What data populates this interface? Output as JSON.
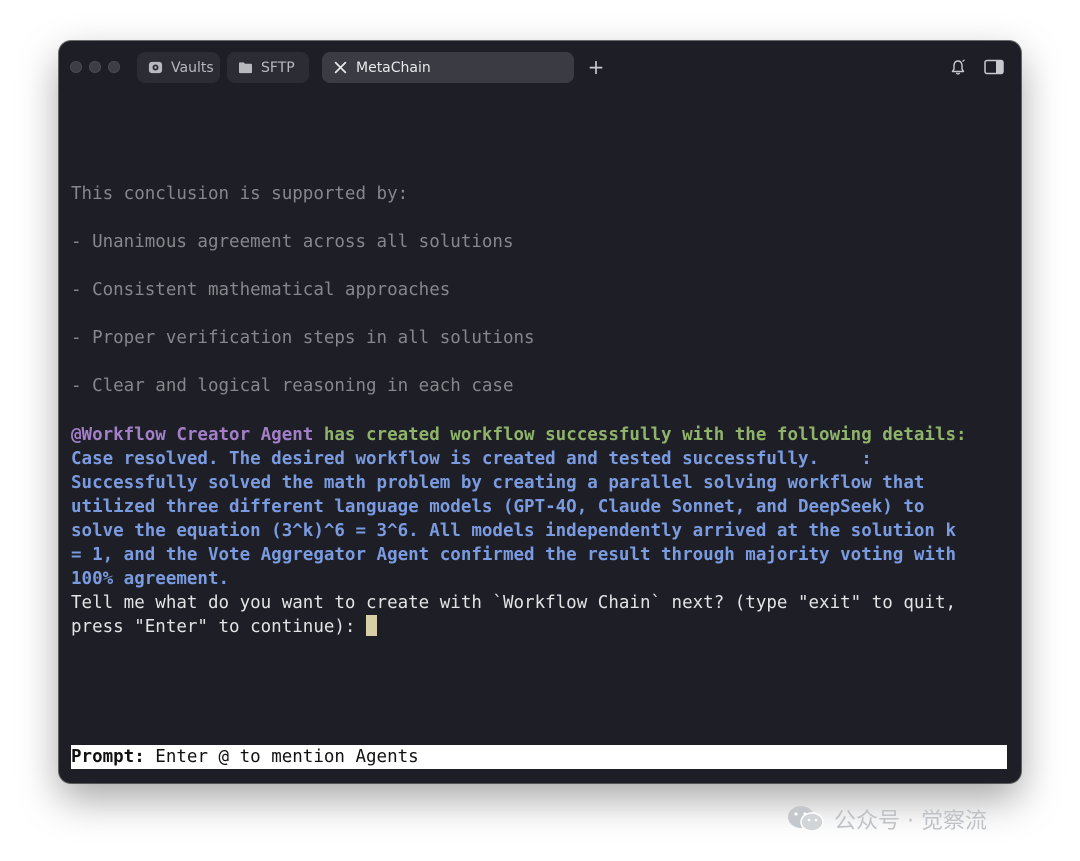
{
  "window": {
    "tabs": [
      {
        "label": "Vaults",
        "icon": "vault-icon"
      },
      {
        "label": "SFTP",
        "icon": "folder-icon"
      },
      {
        "label": "MetaChain",
        "icon": "close-icon",
        "active": true
      }
    ],
    "new_tab": "+",
    "right_icons": [
      "bell-icon",
      "sidebar-toggle-icon"
    ]
  },
  "terminal": {
    "lines": [
      "This conclusion is supported by:",
      "- Unanimous agreement across all solutions",
      "- Consistent mathematical approaches",
      "- Proper verification steps in all solutions",
      "- Clear and logical reasoning in each case"
    ],
    "agent_mention": "@Workflow Creator Agent",
    "agent_message": " has created workflow successfully with the following details:",
    "result_lines": [
      "Case resolved. The desired workflow is created and tested successfully.    :",
      "Successfully solved the math problem by creating a parallel solving workflow that",
      "utilized three different language models (GPT-4O, Claude Sonnet, and DeepSeek) to",
      "solve the equation (3^k)^6 = 3^6. All models independently arrived at the solution k",
      "= 1, and the Vote Aggregator Agent confirmed the result through majority voting with",
      "100% agreement."
    ],
    "question_lines": [
      "Tell me what do you want to create with `Workflow Chain` next? (type \"exit\" to quit,",
      "press \"Enter\" to continue): "
    ]
  },
  "prompt": {
    "label": "Prompt:",
    "placeholder": " Enter @ to mention Agents"
  },
  "watermark": {
    "text": "公众号 · 觉察流"
  },
  "colors": {
    "window_bg": "#1e1f26",
    "dim_text": "#86878c",
    "agent_purple": "#a27fc8",
    "message_green": "#8fb36a",
    "result_blue": "#7b9be0",
    "cursor": "#d7cfa7"
  }
}
